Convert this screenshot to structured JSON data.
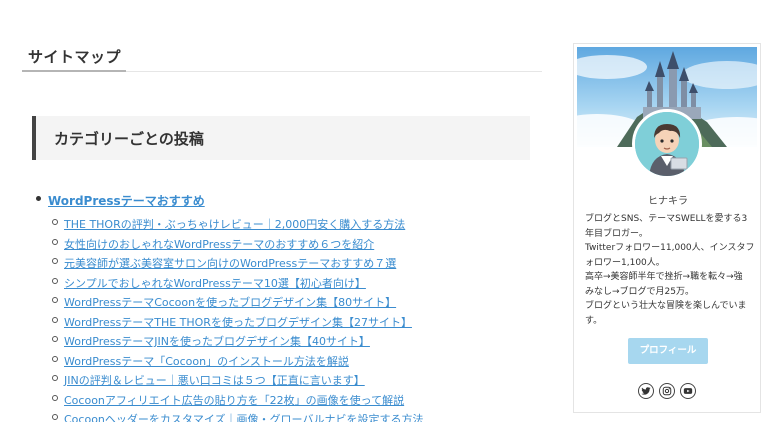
{
  "page": {
    "title": "サイトマップ",
    "section_title": "カテゴリーごとの投稿"
  },
  "categories": [
    {
      "label": "WordPressテーマおすすめ",
      "posts": [
        "THE THORの評判・ぶっちゃけレビュー｜2,000円安く購入する方法",
        "女性向けのおしゃれなWordPressテーマのおすすめ６つを紹介",
        "元美容師が選ぶ美容室サロン向けのWordPressテーマおすすめ７選",
        "シンプルでおしゃれなWordPressテーマ10選【初心者向け】",
        "WordPressテーマCocoonを使ったブログデザイン集【80サイト】",
        "WordPressテーマTHE THORを使ったブログデザイン集【27サイト】",
        "WordPressテーマJINを使ったブログデザイン集【40サイト】",
        "WordPressテーマ「Cocoon」のインストール方法を解説",
        "JINの評判＆レビュー｜悪い口コミは５つ【正直に言います】",
        "Cocoonアフィリエイト広告の貼り方を「22枚」の画像を使って解説",
        "Cocoonヘッダーをカスタマイズ｜画像・グローバルナビを設定する方法"
      ]
    }
  ],
  "profile": {
    "name": "ヒナキラ",
    "bio_lines": [
      "ブログとSNS、テーマSWELLを愛する3",
      "年目ブロガー。",
      "Twitterフォロワー11,000人、インスタフ",
      "ォロワー1,100人。",
      "高卒→美容師半年で挫折→職を転々→強",
      "みなし→ブログで月25万。",
      "ブログという壮大な冒険を楽しんでいま",
      "す。"
    ],
    "button_label": "プロフィール",
    "social": [
      "twitter-icon",
      "instagram-icon",
      "youtube-icon"
    ]
  },
  "colors": {
    "link": "#3a8ccf",
    "button": "#a7d7ef",
    "avatar_bg": "#7fcfd8",
    "section_accent": "#444444"
  }
}
